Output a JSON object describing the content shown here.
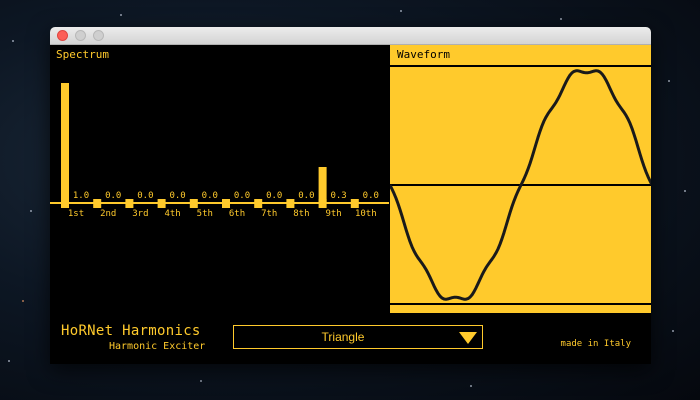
{
  "colors": {
    "accent": "#ffca2c",
    "background": "#000000",
    "close": "#fc5f57"
  },
  "window": {
    "buttons": [
      "close-button",
      "minimize-button",
      "zoom-button"
    ]
  },
  "spectrum": {
    "label": "Spectrum",
    "harmonics": [
      {
        "label": "1st",
        "value_label": "1.0",
        "value": 1.0
      },
      {
        "label": "2nd",
        "value_label": "0.0",
        "value": 0.0
      },
      {
        "label": "3rd",
        "value_label": "0.0",
        "value": 0.0
      },
      {
        "label": "4th",
        "value_label": "0.0",
        "value": 0.0
      },
      {
        "label": "5th",
        "value_label": "0.0",
        "value": 0.0
      },
      {
        "label": "6th",
        "value_label": "0.0",
        "value": 0.0
      },
      {
        "label": "7th",
        "value_label": "0.0",
        "value": 0.0
      },
      {
        "label": "8th",
        "value_label": "0.0",
        "value": 0.0
      },
      {
        "label": "9th",
        "value_label": "0.3",
        "value": 0.3
      },
      {
        "label": "10th",
        "value_label": "0.0",
        "value": 0.0
      }
    ]
  },
  "waveform": {
    "label": "Waveform"
  },
  "footer": {
    "brand": "HoRNet Harmonics",
    "subtitle": "Harmonic Exciter",
    "preset_selected": "Triangle",
    "made_in": "made in Italy"
  }
}
